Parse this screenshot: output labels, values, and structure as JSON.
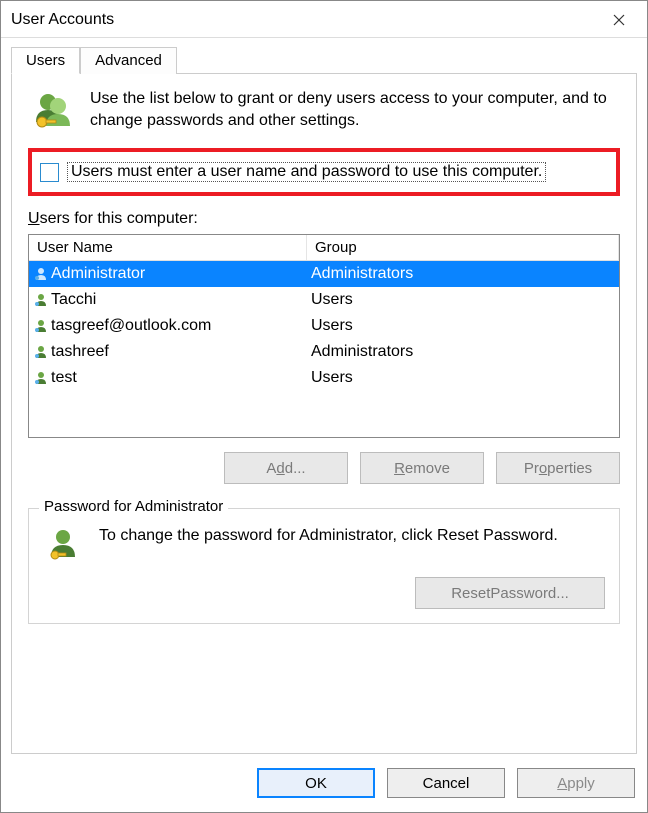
{
  "window": {
    "title": "User Accounts"
  },
  "tabs": {
    "users": "Users",
    "advanced": "Advanced"
  },
  "intro": {
    "text": "Use the list below to grant or deny users access to your computer, and to change passwords and other settings."
  },
  "checkbox": {
    "label_pre": "Users must ",
    "label_mnemonic": "e",
    "label_post": "nter a user name and password to use this computer.",
    "checked": false
  },
  "users_label": {
    "pre": "",
    "mnemonic": "U",
    "post": "sers for this computer:"
  },
  "table": {
    "headers": {
      "name": "User Name",
      "group": "Group"
    },
    "rows": [
      {
        "name": "Administrator",
        "group": "Administrators",
        "selected": true
      },
      {
        "name": "Tacchi",
        "group": "Users",
        "selected": false
      },
      {
        "name": "tasgreef@outlook.com",
        "group": "Users",
        "selected": false
      },
      {
        "name": "tashreef",
        "group": "Administrators",
        "selected": false
      },
      {
        "name": "test",
        "group": "Users",
        "selected": false
      }
    ]
  },
  "buttons": {
    "add_pre": "A",
    "add_mn": "d",
    "add_post": "d...",
    "remove_pre": "",
    "remove_mn": "R",
    "remove_post": "emove",
    "props_pre": "Pr",
    "props_mn": "o",
    "props_post": "perties"
  },
  "password_box": {
    "title": "Password for Administrator",
    "text": "To change the password for Administrator, click Reset Password.",
    "reset_pre": "Reset ",
    "reset_mn": "P",
    "reset_post": "assword..."
  },
  "dialog": {
    "ok": "OK",
    "cancel": "Cancel",
    "apply_pre": "",
    "apply_mn": "A",
    "apply_post": "pply"
  }
}
